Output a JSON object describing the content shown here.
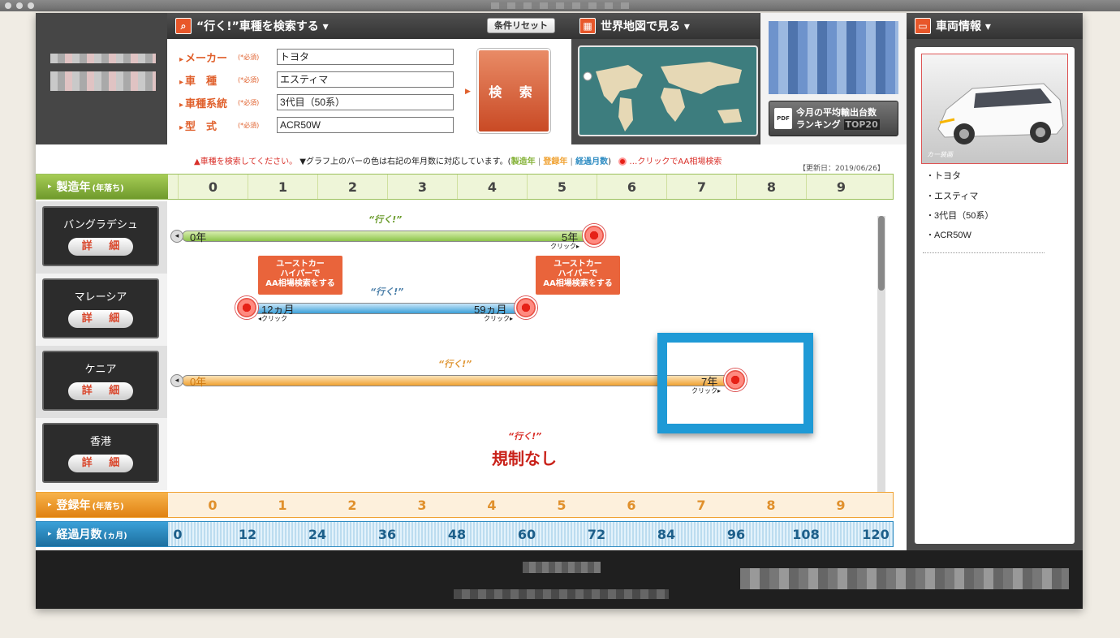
{
  "search": {
    "title": "“行く!”車種を検索する ▾",
    "reset_label": "条件リセット",
    "required": "(*必須)",
    "fields": [
      {
        "label": "メーカー",
        "value": "トヨタ"
      },
      {
        "label": "車　種",
        "value": "エスティマ"
      },
      {
        "label": "車種系統",
        "value": "3代目（50系）"
      },
      {
        "label": "型　式",
        "value": "ACR50W"
      }
    ],
    "button_label": "検 索"
  },
  "map": {
    "title": "世界地図で見る ▾"
  },
  "ranking": {
    "line1": "今月の平均輸出台数",
    "line2": "ランキング",
    "badge": "TOP20",
    "pdf": "PDF"
  },
  "notes": {
    "a": "▲車種を検索してください。",
    "b": "▼グラフ上のバーの色は右記の年月数に対応しています。(",
    "manufacture": "製造年",
    "sep": "|",
    "registration": "登録年",
    "elapsed": "経過月数",
    "close": ")",
    "click": "…クリックでAA相場検索",
    "updated": "【更新日：2019/06/26】"
  },
  "axes": {
    "manufacture": {
      "label": "製造年",
      "sub": "(年落ち)",
      "ticks": [
        "0",
        "1",
        "2",
        "3",
        "4",
        "5",
        "6",
        "7",
        "8",
        "9"
      ]
    },
    "registration": {
      "label": "登録年",
      "sub": "(年落ち)",
      "ticks": [
        "0",
        "1",
        "2",
        "3",
        "4",
        "5",
        "6",
        "7",
        "8",
        "9"
      ]
    },
    "elapsed": {
      "label": "経過月数",
      "sub": "(ヵ月)",
      "ticks": [
        "0",
        "12",
        "24",
        "36",
        "48",
        "60",
        "72",
        "84",
        "96",
        "108",
        "120"
      ]
    }
  },
  "countries": [
    {
      "name": "バングラデシュ",
      "detail": "詳 細",
      "iku": "“行く!”",
      "start": "0年",
      "end": "5年",
      "click_end": "クリック▸"
    },
    {
      "name": "マレーシア",
      "detail": "詳 細",
      "iku": "“行く!”",
      "start": "12ヵ月",
      "end": "59ヵ月",
      "click_start": "◂クリック",
      "click_end": "クリック▸",
      "callout": "ユーストカー\nハイパーで\nAA相場検索をする"
    },
    {
      "name": "ケニア",
      "detail": "詳 細",
      "iku": "“行く!”",
      "start": "0年",
      "end": "7年",
      "click_end": "クリック▸"
    },
    {
      "name": "香港",
      "detail": "詳 細",
      "iku": "“行く!”",
      "none": "規制なし"
    }
  ],
  "vehicle": {
    "title": "車両情報 ▾",
    "caption": "カー装画",
    "items": [
      "トヨタ",
      "エスティマ",
      "3代目（50系）",
      "ACR50W"
    ]
  },
  "colors": {
    "accent": "#e0602c",
    "manufacture": "#86b33a",
    "registration": "#f0a232",
    "elapsed": "#2e8cc2",
    "highlight": "#1f9ad6"
  }
}
